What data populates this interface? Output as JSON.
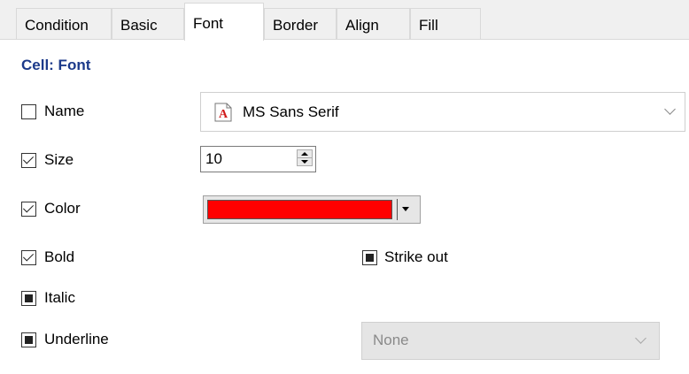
{
  "tabs": [
    {
      "label": "Condition",
      "active": false
    },
    {
      "label": "Basic",
      "active": false
    },
    {
      "label": "Font",
      "active": true
    },
    {
      "label": "Border",
      "active": false
    },
    {
      "label": "Align",
      "active": false
    },
    {
      "label": "Fill",
      "active": false
    }
  ],
  "section_title": "Cell: Font",
  "name": {
    "label": "Name",
    "checked": false,
    "value": "MS Sans Serif",
    "icon": "font-file-icon"
  },
  "size": {
    "label": "Size",
    "checked": true,
    "value": "10"
  },
  "color": {
    "label": "Color",
    "checked": true,
    "value": "#ff0000"
  },
  "bold": {
    "label": "Bold",
    "checked": true
  },
  "strikeout": {
    "label": "Strike out",
    "state": "indeterminate"
  },
  "italic": {
    "label": "Italic",
    "state": "indeterminate"
  },
  "underline": {
    "label": "Underline",
    "state": "indeterminate",
    "style_value": "None",
    "style_enabled": false
  },
  "colors": {
    "accent_title": "#1c3a8a",
    "font_icon_red": "#d11a1a"
  }
}
